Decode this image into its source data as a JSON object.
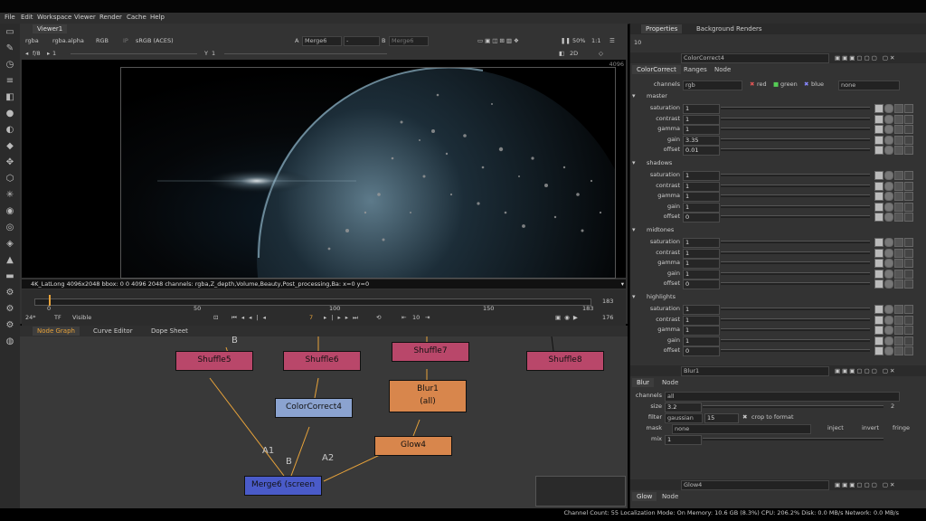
{
  "menu": [
    "File",
    "Edit",
    "Workspace",
    "Viewer",
    "Render",
    "Cache",
    "Help"
  ],
  "viewer": {
    "tab": "Viewer1",
    "channels": "rgba",
    "alpha": "rgba.alpha",
    "colorspace_mode": "RGB",
    "ip_label": "IP",
    "colorspace": "sRGB (ACES)",
    "a_label": "A",
    "a_input": "Merge6",
    "a_dash": "-",
    "b_label": "B",
    "b_input": "Merge6",
    "zoom": "50%",
    "ratio": "1:1",
    "mode": "2D",
    "fstop": "f/8",
    "frame_field": "1",
    "y_label": "Y",
    "y_field": "1",
    "corner_res": "4096",
    "info": "4K_LatLong 4096x2048  bbox: 0 0 4096 2048 channels: rgba,Z_depth,Volume,Beauty,Post_processing,Ba:  x=0 y=0",
    "timeline": {
      "start": "0",
      "mid1": "50",
      "mid2": "100",
      "mid3": "150",
      "end": "183",
      "end_right": "183",
      "fps": "24*",
      "tf": "TF",
      "visible": "Visible",
      "current_frame": "7",
      "step": "10",
      "frame_count": "176"
    }
  },
  "nodegraph": {
    "tabs": [
      "Node Graph",
      "Curve Editor",
      "Dope Sheet"
    ],
    "nodes": {
      "shuffle5": "Shuffle5",
      "shuffle6": "Shuffle6",
      "shuffle7": "Shuffle7",
      "shuffle8": "Shuffle8",
      "colorcorrect4": "ColorCorrect4",
      "blur1": "Blur1",
      "blur1_sub": "(all)",
      "glow4": "Glow4",
      "merge6": "Merge6 (screen"
    },
    "pipes": {
      "a1": "A1",
      "a2": "A2",
      "b": "B",
      "b_top": "B"
    }
  },
  "properties": {
    "tabs": [
      "Properties",
      "Background Renders"
    ],
    "count": "10",
    "cc_node": {
      "name": "ColorCorrect4",
      "tabs": [
        "ColorCorrect",
        "Ranges",
        "Node"
      ],
      "channels_label": "channels",
      "channels": "rgb",
      "red": "red",
      "green": "green",
      "blue": "blue",
      "none": "none",
      "sections": [
        {
          "title": "master",
          "rows": [
            {
              "label": "saturation",
              "value": "1"
            },
            {
              "label": "contrast",
              "value": "1"
            },
            {
              "label": "gamma",
              "value": "1"
            },
            {
              "label": "gain",
              "value": "3.35"
            },
            {
              "label": "offset",
              "value": "0.01"
            }
          ]
        },
        {
          "title": "shadows",
          "rows": [
            {
              "label": "saturation",
              "value": "1"
            },
            {
              "label": "contrast",
              "value": "1"
            },
            {
              "label": "gamma",
              "value": "1"
            },
            {
              "label": "gain",
              "value": "1"
            },
            {
              "label": "offset",
              "value": "0"
            }
          ]
        },
        {
          "title": "midtones",
          "rows": [
            {
              "label": "saturation",
              "value": "1"
            },
            {
              "label": "contrast",
              "value": "1"
            },
            {
              "label": "gamma",
              "value": "1"
            },
            {
              "label": "gain",
              "value": "1"
            },
            {
              "label": "offset",
              "value": "0"
            }
          ]
        },
        {
          "title": "highlights",
          "rows": [
            {
              "label": "saturation",
              "value": "1"
            },
            {
              "label": "contrast",
              "value": "1"
            },
            {
              "label": "gamma",
              "value": "1"
            },
            {
              "label": "gain",
              "value": "1"
            },
            {
              "label": "offset",
              "value": "0"
            }
          ]
        }
      ]
    },
    "blur_node": {
      "name": "Blur1",
      "tabs": [
        "Blur",
        "Node"
      ],
      "channels_label": "channels",
      "channels": "all",
      "size_label": "size",
      "size": "3.2",
      "size_right": "2",
      "filter_label": "filter",
      "filter": "gaussian",
      "quality": "15",
      "crop": "crop to format",
      "mask_label": "mask",
      "mask": "none",
      "inject": "inject",
      "invert": "invert",
      "fringe": "fringe",
      "mix_label": "mix",
      "mix": "1"
    },
    "glow_node": {
      "name": "Glow4",
      "tabs": [
        "Glow",
        "Node"
      ]
    }
  },
  "status": "Channel Count: 55  Localization Mode: On  Memory: 10.6 GB (8.3%)  CPU: 206.2%  Disk: 0.0 MB/s  Network: 0.0 MB/s"
}
